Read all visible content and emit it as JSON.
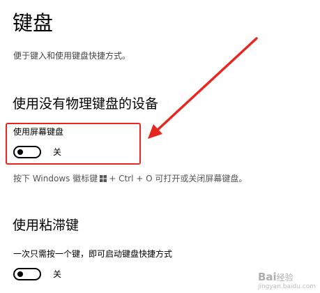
{
  "page": {
    "title": "键盘",
    "description": "便于键入和使用键盘快捷方式。"
  },
  "section_onscreen": {
    "title": "使用没有物理键盘的设备",
    "setting_label": "使用屏幕键盘",
    "toggle_state": "关",
    "toggle_on": false,
    "hint_pre": "按下 Windows 徽标键",
    "hint_post": "+ Ctrl + O 可打开或关闭屏幕键盘。"
  },
  "section_sticky": {
    "title": "使用粘滞键",
    "setting_label": "一次只需按一个键，即可启动键盘快捷方式",
    "toggle_state": "关",
    "toggle_on": false
  },
  "annotation": {
    "color": "#e8261f"
  },
  "watermark": {
    "brand": "Bai",
    "brand_suffix": "经验",
    "url": "jingyan.baidu.com"
  },
  "icons": [
    "windows-logo-icon",
    "arrow-annotation-icon"
  ]
}
